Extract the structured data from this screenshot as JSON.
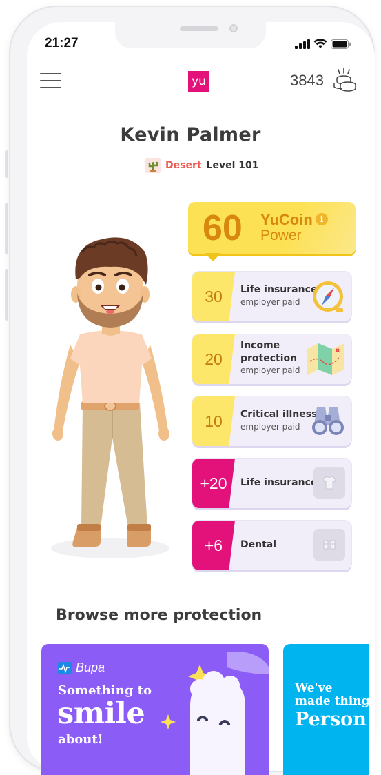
{
  "status_bar": {
    "time": "21:27"
  },
  "header": {
    "logo_text": "yu",
    "coin_balance": "3843",
    "icons": {
      "menu": "menu-icon",
      "coins": "coin-stack-icon"
    }
  },
  "profile": {
    "name": "Kevin Palmer",
    "biome": "Desert",
    "level": "Level 101"
  },
  "power": {
    "value": "60",
    "title": "YuCoin",
    "subtitle": "Power",
    "info_glyph": "i"
  },
  "benefits": [
    {
      "value": "30",
      "label": "Life insurance",
      "sub": "employer paid",
      "style": "yellow",
      "icon": "compass-icon"
    },
    {
      "value": "20",
      "label_1": "Income",
      "label_2": "protection",
      "sub": "employer paid",
      "style": "yellow",
      "icon": "map-icon"
    },
    {
      "value": "10",
      "label": "Critical illness",
      "sub": "employer paid",
      "style": "yellow",
      "icon": "binoculars-icon"
    },
    {
      "value": "+20",
      "label": "Life insurance",
      "style": "pink",
      "icon": "tshirt-icon"
    },
    {
      "value": "+6",
      "label": "Dental",
      "style": "pink",
      "icon": "boots-icon"
    }
  ],
  "browse": {
    "title": "Browse more protection",
    "promos": [
      {
        "brand": "Bupa",
        "line1": "Something to",
        "line2": "smile",
        "line3": "about!",
        "color": "#8b5cf6"
      },
      {
        "line1": "We've",
        "line2": "made thing",
        "line3": "Person",
        "color": "#00b4f0"
      }
    ]
  },
  "colors": {
    "brand_pink": "#e2127a",
    "power_yellow": "#fde154",
    "coin_text": "#d8870f",
    "card_bg": "#f1eefa"
  }
}
